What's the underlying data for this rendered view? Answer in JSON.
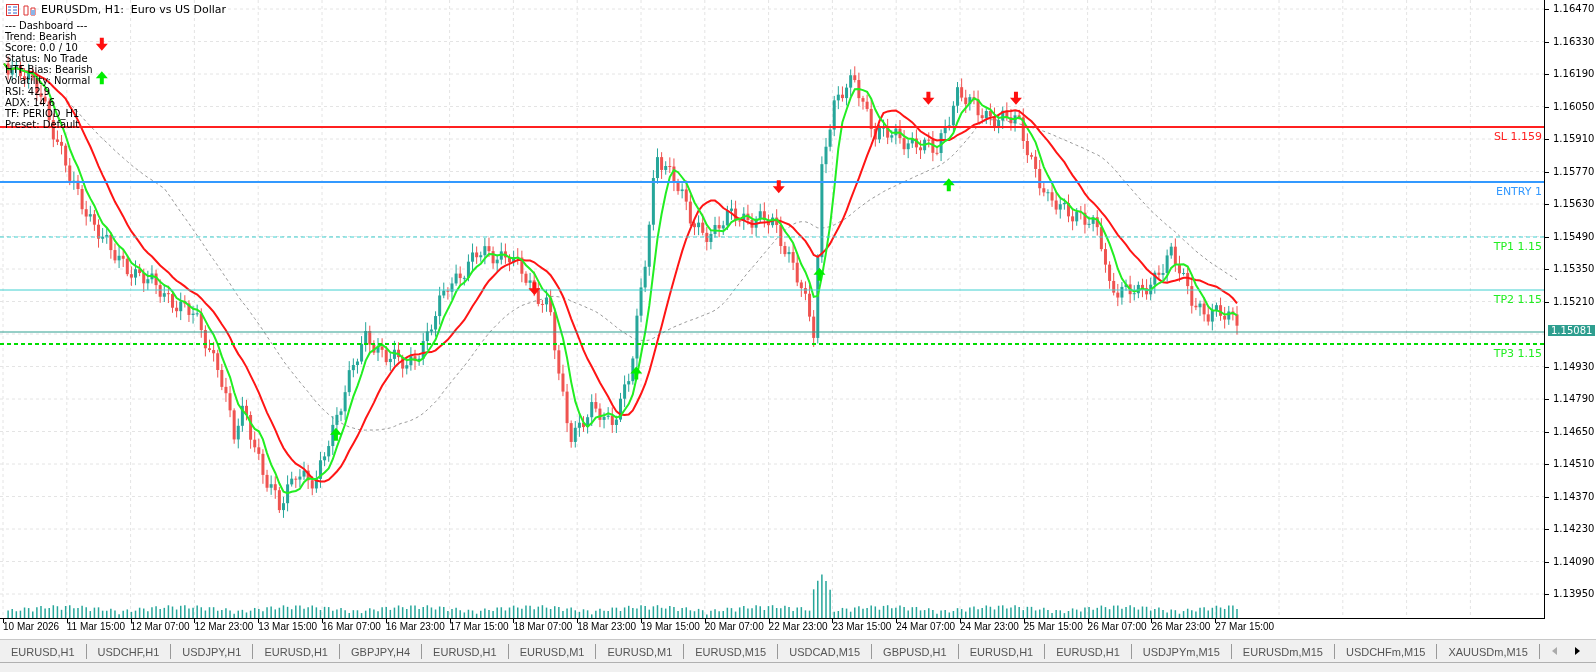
{
  "window": {
    "title": "EURUSDm, H1:  Euro vs US Dollar"
  },
  "dashboard": {
    "lines": [
      "--- Dashboard ---",
      "Trend: Bearish",
      "Score: 0.0 / 10",
      "Status: No Trade",
      "HTF Bias: Bearish",
      "Volatility: Normal",
      "RSI: 42.9",
      "ADX: 14.6",
      "TF: PERIOD_H1",
      "Preset: Default"
    ]
  },
  "level_lines": [
    {
      "label": "SL 1.159",
      "kind": "stop",
      "color": "#ff2020"
    },
    {
      "label": "ENTRY 1",
      "kind": "entry",
      "color": "#3399ff"
    },
    {
      "label": "TP1 1.15",
      "kind": "target",
      "color": "#22ee22"
    },
    {
      "label": "TP2 1.15",
      "kind": "target",
      "color": "#22ee22"
    },
    {
      "label": "TP3 1.15",
      "kind": "target",
      "color": "#22ee22"
    }
  ],
  "price_axis": {
    "labels": [
      "1.16470",
      "1.16330",
      "1.16190",
      "1.16050",
      "1.15910",
      "1.15770",
      "1.15630",
      "1.15490",
      "1.15350",
      "1.15210",
      "1.14930",
      "1.14790",
      "1.14650",
      "1.14510",
      "1.14370",
      "1.14230",
      "1.14090",
      "1.13950"
    ],
    "current_price": "1.15081"
  },
  "time_axis": {
    "labels": [
      "10 Mar 2026",
      "11 Mar 15:00",
      "12 Mar 07:00",
      "12 Mar 23:00",
      "13 Mar 15:00",
      "16 Mar 07:00",
      "16 Mar 23:00",
      "17 Mar 15:00",
      "18 Mar 07:00",
      "18 Mar 23:00",
      "19 Mar 15:00",
      "20 Mar 07:00",
      "22 Mar 23:00",
      "23 Mar 15:00",
      "24 Mar 07:00",
      "24 Mar 23:00",
      "25 Mar 15:00",
      "26 Mar 07:00",
      "26 Mar 23:00",
      "27 Mar 15:00"
    ]
  },
  "tabs": [
    {
      "label": "EURUSD,H1"
    },
    {
      "label": "USDCHF,H1"
    },
    {
      "label": "USDJPY,H1"
    },
    {
      "label": "EURUSD,H1"
    },
    {
      "label": "GBPJPY,H4"
    },
    {
      "label": "EURUSD,H1"
    },
    {
      "label": "EURUSD,M1"
    },
    {
      "label": "EURUSD,M1"
    },
    {
      "label": "EURUSD,M15"
    },
    {
      "label": "USDCAD,M15"
    },
    {
      "label": "GBPUSD,H1"
    },
    {
      "label": "EURUSD,H1"
    },
    {
      "label": "EURUSD,H1"
    },
    {
      "label": "USDJPYm,M15"
    },
    {
      "label": "EURUSDm,M15"
    },
    {
      "label": "USDCHFm,M15"
    },
    {
      "label": "XAUUSDm,M15"
    }
  ]
}
